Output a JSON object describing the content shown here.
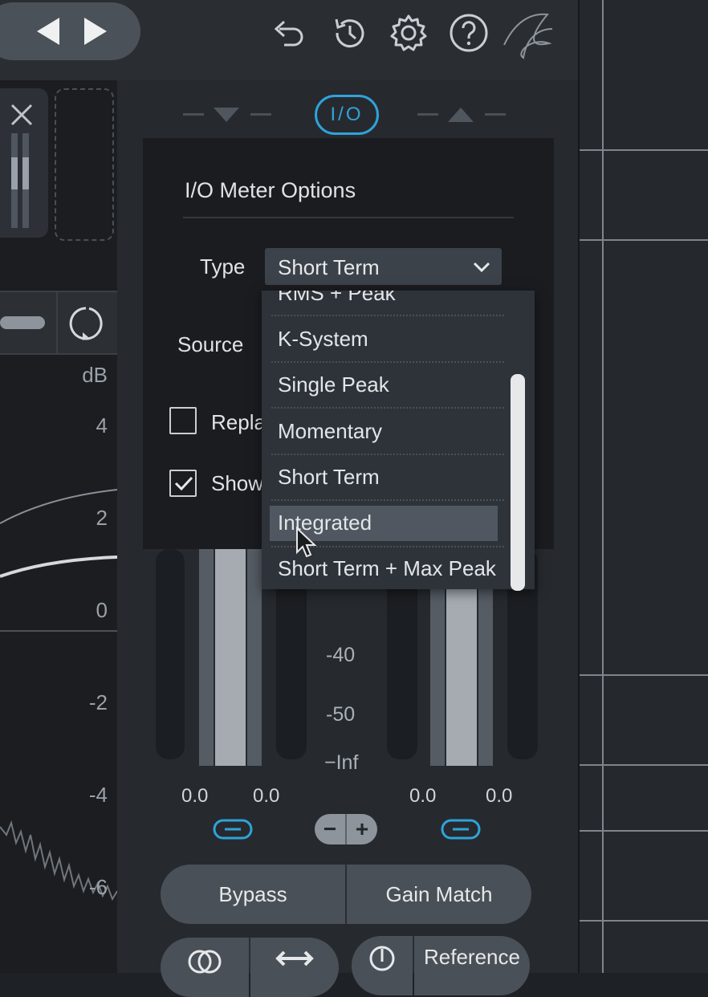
{
  "toolbar": {
    "prev_icon": "triangle-left-icon",
    "next_icon": "triangle-right-icon",
    "icons": [
      "undo-icon",
      "history-icon",
      "gear-icon",
      "help-icon",
      "logo-icon"
    ]
  },
  "io_tab": {
    "label": "I/O"
  },
  "options": {
    "title": "I/O Meter Options",
    "type_label": "Type",
    "type_value": "Short Term",
    "source_label": "Source",
    "replace_label": "Repla",
    "show_label": "Show",
    "replace_checked": false,
    "show_checked": true
  },
  "dropdown": {
    "items": [
      "RMS + Peak",
      "K-System",
      "Single Peak",
      "Momentary",
      "Short Term",
      "Integrated",
      "Short Term + Max Peak"
    ],
    "highlighted": "Integrated"
  },
  "db_scale": {
    "unit": "dB",
    "ticks": [
      "4",
      "2",
      "0",
      "-2",
      "-4",
      "-6"
    ]
  },
  "meter_scale": [
    "-40",
    "-50",
    "−Inf"
  ],
  "meter_values": {
    "in_left": "0.0",
    "in_right": "0.0",
    "out_left": "0.0",
    "out_right": "0.0"
  },
  "gain_controls": {
    "minus": "−",
    "plus": "+"
  },
  "buttons": {
    "bypass": "Bypass",
    "gain_match": "Gain Match",
    "reference": "Reference"
  },
  "colors": {
    "accent": "#2fa3d9",
    "panel": "#1a1c20",
    "highlight": "#505760"
  }
}
